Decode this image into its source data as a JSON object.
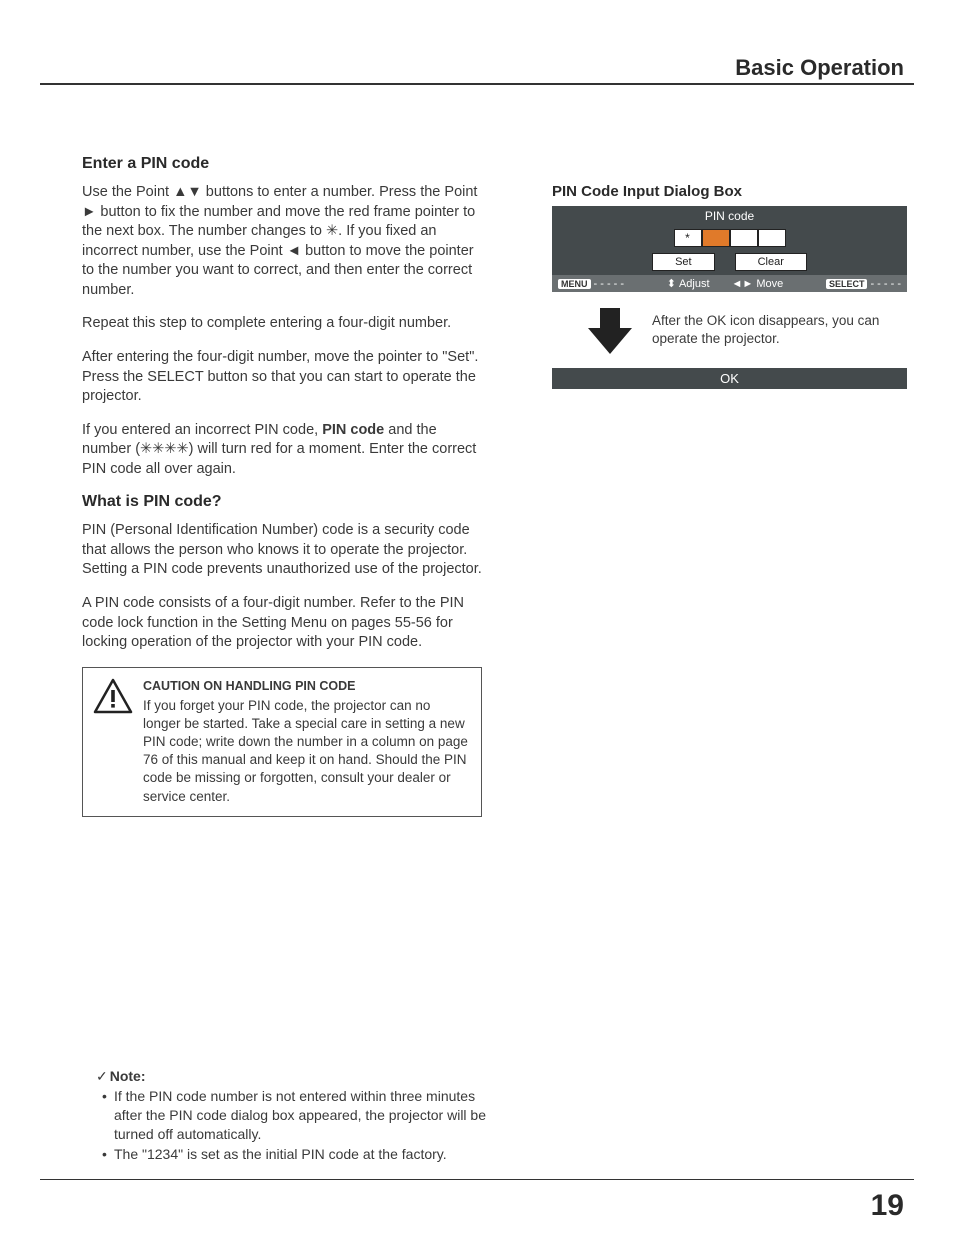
{
  "header": {
    "section": "Basic Operation"
  },
  "page_number": "19",
  "left": {
    "h_enter": "Enter a PIN code",
    "p1a": "Use the Point ",
    "p1b": " buttons to enter a number. Press the Point ",
    "p1c": " button to fix the number and move the red frame pointer to the next box. The number changes to ",
    "p1d": ". If you fixed an incorrect number, use the Point ",
    "p1e": " button to move the pointer to the number you want to correct, and then enter the correct number.",
    "sym_updown": "▲▼",
    "sym_right": "►",
    "sym_star": "✳",
    "sym_left": "◄",
    "p2": "Repeat this step to complete entering a four-digit number.",
    "p3": "After entering the four-digit number, move the pointer to \"Set\". Press the SELECT button so that you can start to operate the projector.",
    "p4a": "If you entered an incorrect PIN code, ",
    "p4b": "PIN code",
    "p4c": " and the number (",
    "p4d": "✳✳✳✳",
    "p4e": ") will turn red for a moment. Enter the correct PIN code all over again.",
    "h_what": "What is PIN code?",
    "p5": "PIN (Personal Identification Number) code is a security code that allows the person who knows it to operate the projector. Setting a PIN code prevents unauthorized use of the projector.",
    "p6": "A PIN code consists of a four-digit number. Refer to the PIN code lock function in the Setting Menu on pages 55-56 for locking operation of the projector with your PIN code.",
    "caution_title": "CAUTION ON HANDLING PIN CODE",
    "caution_body": "If you forget your PIN code, the projector can no longer be started. Take a special care in setting a new PIN code; write down the number in a column on page 76 of this manual and keep it on hand. Should the PIN code be missing or forgotten, consult your dealer or service center."
  },
  "right": {
    "title": "PIN Code Input Dialog Box",
    "pin_label": "PIN code",
    "set": "Set",
    "clear": "Clear",
    "menu": "MENU",
    "adjust": "Adjust",
    "move": "Move",
    "select": "SELECT",
    "dashes": "- - - - -",
    "after_ok": "After the OK icon disappears, you can operate the projector.",
    "ok": "OK",
    "entered": "*"
  },
  "note": {
    "heading": "Note:",
    "check": "✓",
    "item1": "If the PIN code number is not entered within three minutes after the PIN code dialog box appeared, the projector will be turned off automatically.",
    "item2": "The \"1234\" is set as the initial PIN code at the factory."
  }
}
